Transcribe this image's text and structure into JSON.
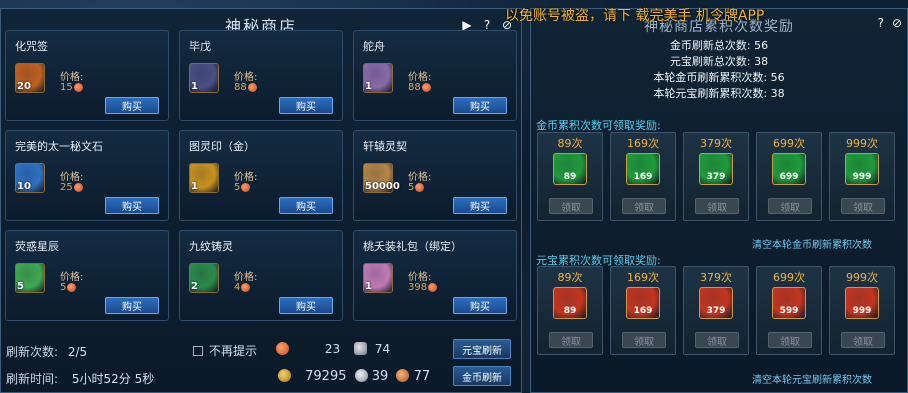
{
  "shop": {
    "title": "神秘商店",
    "price_label": "价格:",
    "buy_label": "购买",
    "items": [
      {
        "name": "化咒签",
        "qty": "20",
        "price": "15",
        "color": "#c0601f"
      },
      {
        "name": "毕戊",
        "qty": "1",
        "price": "88",
        "color": "#4a4f84"
      },
      {
        "name": "舵舟",
        "qty": "1",
        "price": "88",
        "color": "#8a6aa8"
      },
      {
        "name": "完美的太一秘文石",
        "qty": "10",
        "price": "25",
        "color": "#2f6fc2"
      },
      {
        "name": "图灵印（金）",
        "qty": "1",
        "price": "5",
        "color": "#c8921f"
      },
      {
        "name": "轩辕灵契",
        "qty": "50000",
        "price": "5",
        "color": "#b58646"
      },
      {
        "name": "荧惑星辰",
        "qty": "5",
        "price": "5",
        "color": "#3fa850"
      },
      {
        "name": "九纹铸灵",
        "qty": "2",
        "price": "4",
        "color": "#2c8a4a"
      },
      {
        "name": "桃夭装礼包（绑定）",
        "qty": "1",
        "price": "398",
        "color": "#c07ab5"
      }
    ]
  },
  "footer": {
    "refresh_count_label": "刷新次数:",
    "refresh_count": "2/5",
    "no_prompt_label": "不再提示",
    "refresh_time_label": "刷新时间:",
    "refresh_time": "5小时52分 5秒",
    "currency_a": "23",
    "currency_b": "74",
    "gold": "79295",
    "silver": "39",
    "bronze": "77",
    "yuanbao_refresh_label": "元宝刷新",
    "gold_refresh_label": "金币刷新"
  },
  "rewards": {
    "title": "神秘商店累积次数奖励",
    "warning": "以免账号被盗，请下 载完美手 机令牌APP",
    "stats": [
      {
        "label": "金币刷新总次数:",
        "value": "56"
      },
      {
        "label": "元宝刷新总次数:",
        "value": "38"
      },
      {
        "label": "本轮金币刷新累积次数:",
        "value": "56"
      },
      {
        "label": "本轮元宝刷新累积次数:",
        "value": "38"
      }
    ],
    "gold_section_title": "金币累积次数可领取奖励:",
    "yuanbao_section_title": "元宝累积次数可领取奖励:",
    "claim_label": "领取",
    "gold_clear_label": "清空本轮金币刷新累积次数",
    "yuanbao_clear_label": "清空本轮元宝刷新累积次数",
    "tiers": [
      {
        "count": "89次",
        "gold_num": "89",
        "yuanbao_num": "89"
      },
      {
        "count": "169次",
        "gold_num": "169",
        "yuanbao_num": "169"
      },
      {
        "count": "379次",
        "gold_num": "379",
        "yuanbao_num": "379"
      },
      {
        "count": "699次",
        "gold_num": "699",
        "yuanbao_num": "599"
      },
      {
        "count": "999次",
        "gold_num": "999",
        "yuanbao_num": "999"
      }
    ],
    "gold_icon_color": "#1f9a3a",
    "yuanbao_icon_color": "#c4351f"
  }
}
